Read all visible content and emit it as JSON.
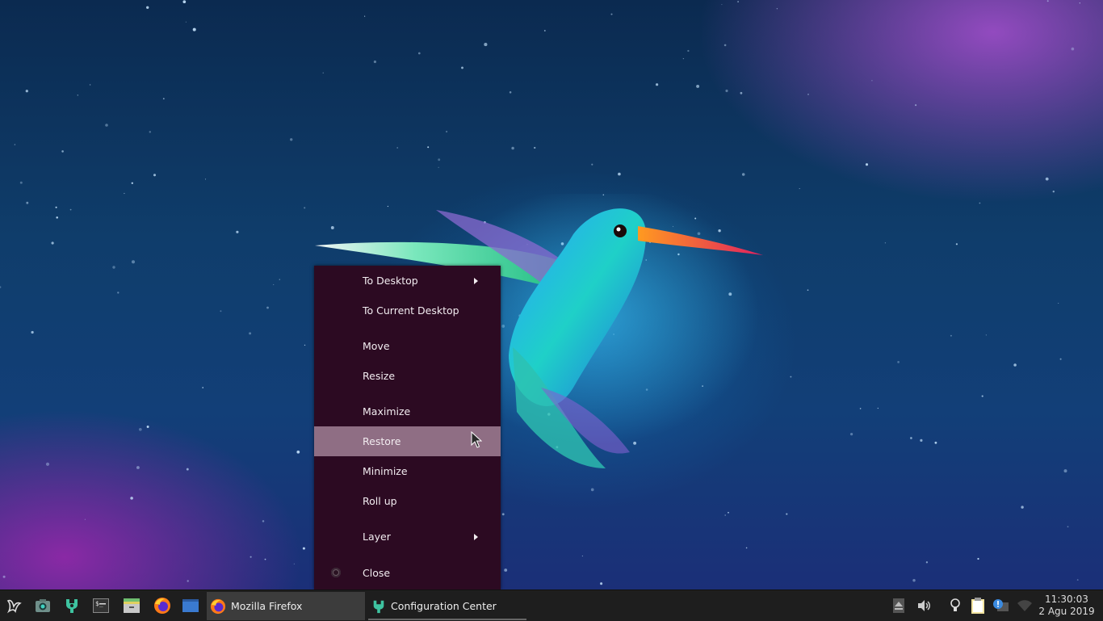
{
  "menu": {
    "items": [
      {
        "label": "To Desktop",
        "submenu": true
      },
      {
        "label": "To Current Desktop"
      },
      {
        "label": "Move"
      },
      {
        "label": "Resize"
      },
      {
        "label": "Maximize"
      },
      {
        "label": "Restore",
        "highlighted": true
      },
      {
        "label": "Minimize"
      },
      {
        "label": "Roll up"
      },
      {
        "label": "Layer",
        "submenu": true
      },
      {
        "label": "Close",
        "radio": true
      }
    ]
  },
  "taskbar": {
    "launchers": [
      "start-menu-icon",
      "screenshot-icon",
      "config-center-icon",
      "terminal-icon",
      "file-manager-icon",
      "firefox-icon",
      "desktop-icon"
    ],
    "tasks": [
      {
        "label": "Mozilla Firefox",
        "icon": "firefox-icon",
        "active": true
      },
      {
        "label": "Configuration Center",
        "icon": "config-center-icon"
      }
    ],
    "tray": [
      "eject-icon",
      "volume-icon",
      "lightbulb-icon",
      "clipboard-icon",
      "notification-icon",
      "wifi-icon"
    ],
    "clock": {
      "time": "11:30:03",
      "date": "2 Agu 2019"
    }
  },
  "colors": {
    "menu_bg": "#2c0a22",
    "menu_highlight": "#8f6e84",
    "taskbar_bg": "#1e1e1e"
  }
}
